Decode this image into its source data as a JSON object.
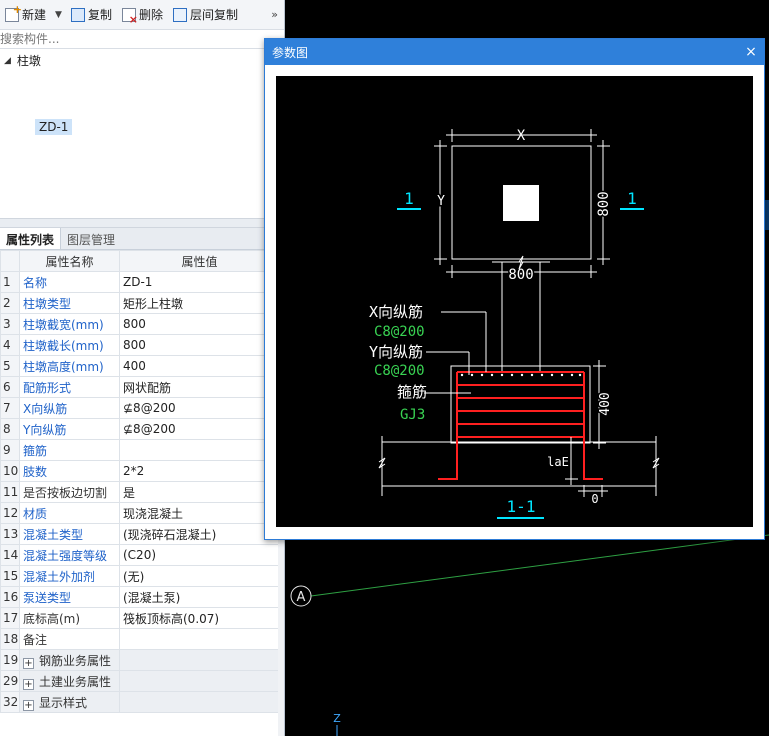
{
  "toolbar": {
    "new_label": "新建",
    "copy_label": "复制",
    "delete_label": "删除",
    "floor_copy_label": "层间复制"
  },
  "search": {
    "placeholder": "搜索构件..."
  },
  "tree": {
    "root_label": "柱墩",
    "leaf_label": "ZD-1"
  },
  "tabs": {
    "properties": "属性列表",
    "layers": "图层管理"
  },
  "table": {
    "col_name": "属性名称",
    "col_value": "属性值",
    "rows": [
      {
        "num": "1",
        "name": "名称",
        "value": "ZD-1"
      },
      {
        "num": "2",
        "name": "柱墩类型",
        "value": "矩形上柱墩"
      },
      {
        "num": "3",
        "name": "柱墩截宽(mm)",
        "value": "800"
      },
      {
        "num": "4",
        "name": "柱墩截长(mm)",
        "value": "800"
      },
      {
        "num": "5",
        "name": "柱墩高度(mm)",
        "value": "400"
      },
      {
        "num": "6",
        "name": "配筋形式",
        "value": "网状配筋"
      },
      {
        "num": "7",
        "name": "X向纵筋",
        "value": "⊈8@200"
      },
      {
        "num": "8",
        "name": "Y向纵筋",
        "value": "⊈8@200"
      },
      {
        "num": "9",
        "name": "箍筋",
        "value": ""
      },
      {
        "num": "10",
        "name": "肢数",
        "value": "2*2"
      },
      {
        "num": "11",
        "name": "是否按板边切割",
        "value": "是"
      },
      {
        "num": "12",
        "name": "材质",
        "value": "现浇混凝土"
      },
      {
        "num": "13",
        "name": "混凝土类型",
        "value": "(现浇碎石混凝土)"
      },
      {
        "num": "14",
        "name": "混凝土强度等级",
        "value": "(C20)"
      },
      {
        "num": "15",
        "name": "混凝土外加剂",
        "value": "(无)"
      },
      {
        "num": "16",
        "name": "泵送类型",
        "value": "(混凝土泵)"
      },
      {
        "num": "17",
        "name": "底标高(m)",
        "value": "筏板顶标高(0.07)"
      },
      {
        "num": "18",
        "name": "备注",
        "value": ""
      }
    ],
    "groups": [
      {
        "num": "19",
        "name": "钢筋业务属性"
      },
      {
        "num": "29",
        "name": "土建业务属性"
      },
      {
        "num": "32",
        "name": "显示样式"
      }
    ]
  },
  "dialog": {
    "title": "参数图",
    "close": "×"
  },
  "drawing": {
    "dim_x": "X",
    "dim_y": "Y",
    "dim_800_bottom": "800",
    "dim_800_right": "800",
    "sec_mark_left": "1",
    "sec_mark_right": "1",
    "lbl_x_rebar": "X向纵筋",
    "val_x_rebar": "C8@200",
    "lbl_y_rebar": "Y向纵筋",
    "val_y_rebar": "C8@200",
    "lbl_stirrup": "箍筋",
    "val_stirrup": "GJ3",
    "dim_400": "400",
    "dim_lae": "laE",
    "dim_0": "0",
    "section_title": "1-1"
  },
  "canvas": {
    "axis_label": "A",
    "z_label": "Z"
  },
  "colors": {
    "accent": "#2f80da",
    "cad_cyan": "#00e5ff",
    "cad_green": "#39d353",
    "cad_red": "#ff2020"
  }
}
